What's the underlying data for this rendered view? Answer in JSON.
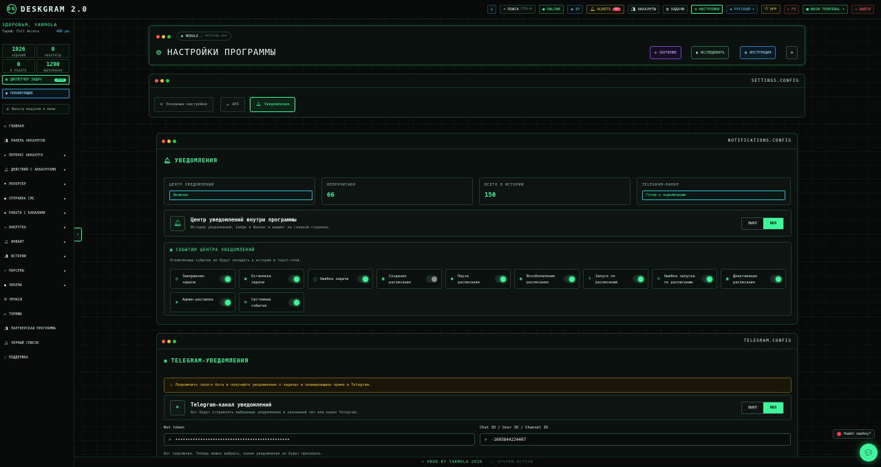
{
  "app": {
    "title": "DESKGRAM 2.0"
  },
  "topbar": {
    "search_label": "ПОИСК",
    "search_kbd": "CTRL+K",
    "online": "ONLINE",
    "ip": "IP",
    "alerts": "ALERTS",
    "alerts_count": "66",
    "accounts": "АККАУНТЫ",
    "tasks": "ЗАДАЧИ",
    "settings": "НАСТРОЙКИ",
    "language": "РУССКИЙ",
    "off": "OFF",
    "fx": "FX",
    "theme": "NEON TERMINAL",
    "logout": "ВЫЙТИ"
  },
  "sidebar": {
    "greeting": "ЗДОРОВЬЯ, YARMOLA",
    "tariff": "Тариф: Full Access",
    "days": "486 дн.",
    "stats": [
      {
        "value": "1926",
        "label": "ЗАДАНИЙ"
      },
      {
        "value": "0",
        "label": "АККАУНТЫ"
      },
      {
        "value": "0",
        "label": "В РАБОТЕ"
      },
      {
        "value": "1290",
        "label": "ВЫПОЛНЕНО"
      }
    ],
    "dispatcher": "ДИСПЕТЧЕР ЗАДАЧ",
    "dispatcher_badge": "1926",
    "scheduler": "ПЛАНИРОВЩИК",
    "filter_placeholder": "Фильтр модулей в меню",
    "nav": [
      "ГЛАВНАЯ",
      "ПАНЕЛЬ АККАУНТОВ",
      "ПЕРЕНОС АККАУНТА",
      "ДЕЙСТВИЯ С АККАУНТАМИ",
      "РЕПОРТЕР",
      "ОТПРАВКА СМС",
      "РАБОТА С КАНАЛАМИ",
      "НАКРУТКА",
      "ИНВАЙТ",
      "ИСТОРИИ",
      "ПАРСЕРЫ",
      "ЧЕКЕРЫ",
      "ПРОКСИ",
      "ТАРИФЫ",
      "ПАРТНЕРСКАЯ ПРОГРАММА",
      "ЧЕРНЫЙ СПИСОК",
      "ПОДДЕРЖКА"
    ]
  },
  "header": {
    "module_label": "MODULE",
    "module_file": "settings.exe",
    "title": "НАСТРОЙКИ ПРОГРАММЫ",
    "btn_learn": "ОБУЧЕНИЕ",
    "btn_explore": "ИССЛЕДОВАТЬ",
    "btn_instr": "ИНСТРУКЦИЯ"
  },
  "tabs": {
    "config": "SETTINGS.CONFIG",
    "items": [
      "Основные настройки",
      "API",
      "Уведомления"
    ]
  },
  "notifications": {
    "config": "NOTIFICATIONS.CONFIG",
    "title": "УВЕДОМЛЕНИЯ",
    "mini": [
      {
        "label": "ЦЕНТР УВЕДОМЛЕНИЙ",
        "value": "Включен"
      },
      {
        "label": "НЕПРОЧИТАНО",
        "value": "66"
      },
      {
        "label": "ВСЕГО В ИСТОРИИ",
        "value": "150"
      },
      {
        "label": "TELEGRAM-КАНАЛ",
        "value": "Готов к подключению"
      }
    ],
    "center_title": "Центр уведомлений внутри программы",
    "center_sub": "История уведомлений, badge в Navbar и виджет на главной странице.",
    "off": "ВЫКЛ",
    "on": "ВКЛ",
    "events_title": "СОБЫТИЯ ЦЕНТРА УВЕДОМЛЕНИЙ",
    "events_sub": "Отключённые события не будут попадать в историю и toast-слой.",
    "events": [
      {
        "label": "Завершение задачи",
        "on": true
      },
      {
        "label": "Остановка задачи",
        "on": true
      },
      {
        "label": "Ошибка задачи",
        "on": true
      },
      {
        "label": "Создание расписания",
        "on": false
      },
      {
        "label": "Пауза расписания",
        "on": true
      },
      {
        "label": "Возобновление расписания",
        "on": true
      },
      {
        "label": "Запуск по расписанию",
        "on": true
      },
      {
        "label": "Ошибка запуска по расписанию",
        "on": true
      },
      {
        "label": "Деактивация расписания",
        "on": true
      },
      {
        "label": "Админ-рассылка",
        "on": true
      },
      {
        "label": "Системные события",
        "on": true
      }
    ]
  },
  "telegram": {
    "config": "TELEGRAM.CONFIG",
    "title": "TELEGRAM-УВЕДОМЛЕНИЯ",
    "warn": "Подключите своего бота и получайте уведомления о задачах и планировщике прямо в Telegram.",
    "channel_title": "Telegram-канал уведомлений",
    "channel_sub": "Бот будет отправлять выбранные уведомления в указанный чат или канал Telegram.",
    "off": "ВЫКЛ",
    "on": "ВКЛ",
    "token_label": "Bot token",
    "token_value": "••••••••••••••••••••••••••••••••••••••••••••••",
    "chat_label": "Chat ID / User ID / Channel ID",
    "chat_value": "-1003844224407",
    "hint": "Бот подключен. Теперь можно выбрать, какие уведомления он будет присылать."
  },
  "footer": {
    "left": "• PROD BY YARMOLA 2026",
    "right": "// SYSTEM ACTIVE"
  },
  "help": {
    "label": "Нашёл ошибку?"
  }
}
